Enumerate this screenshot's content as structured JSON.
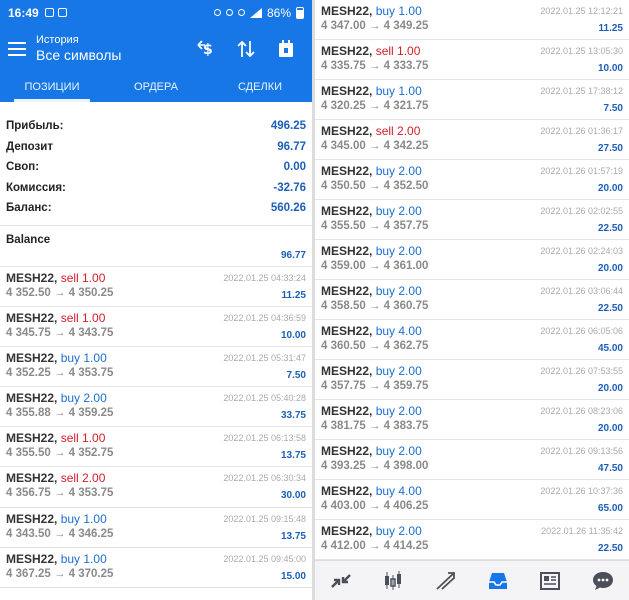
{
  "status": {
    "time": "16:49",
    "battery": "86%"
  },
  "toolbar": {
    "subtitle": "История",
    "title": "Все символы"
  },
  "tabs": [
    {
      "label": "ПОЗИЦИИ"
    },
    {
      "label": "ОРДЕРА"
    },
    {
      "label": "СДЕЛКИ"
    }
  ],
  "summary": [
    {
      "label": "Прибыль:",
      "value": "496.25"
    },
    {
      "label": "Депозит",
      "value": "96.77"
    },
    {
      "label": "Своп:",
      "value": "0.00"
    },
    {
      "label": "Комиссия:",
      "value": "-32.76"
    },
    {
      "label": "Баланс:",
      "value": "560.26"
    }
  ],
  "balance": {
    "title": "Balance",
    "value": "96.77"
  },
  "left_trades": [
    {
      "symbol": "MESH22,",
      "direction": "sell 1.00",
      "type": "sell",
      "prices": "4 352.50 → 4 350.25",
      "date": "2022.01.25 04:33:24",
      "profit": "11.25"
    },
    {
      "symbol": "MESH22,",
      "direction": "sell 1.00",
      "type": "sell",
      "prices": "4 345.75 → 4 343.75",
      "date": "2022.01.25 04:36:59",
      "profit": "10.00"
    },
    {
      "symbol": "MESH22,",
      "direction": "buy 1.00",
      "type": "buy",
      "prices": "4 352.25 → 4 353.75",
      "date": "2022.01.25 05:31:47",
      "profit": "7.50"
    },
    {
      "symbol": "MESH22,",
      "direction": "buy 2.00",
      "type": "buy",
      "prices": "4 355.88 → 4 359.25",
      "date": "2022.01.25 05:40:28",
      "profit": "33.75"
    },
    {
      "symbol": "MESH22,",
      "direction": "sell 1.00",
      "type": "sell",
      "prices": "4 355.50 → 4 352.75",
      "date": "2022.01.25 06:13:58",
      "profit": "13.75"
    },
    {
      "symbol": "MESH22,",
      "direction": "sell 2.00",
      "type": "sell",
      "prices": "4 356.75 → 4 353.75",
      "date": "2022.01.25 06:30:34",
      "profit": "30.00"
    },
    {
      "symbol": "MESH22,",
      "direction": "buy 1.00",
      "type": "buy",
      "prices": "4 343.50 → 4 346.25",
      "date": "2022.01.25 09:15:48",
      "profit": "13.75"
    },
    {
      "symbol": "MESH22,",
      "direction": "buy 1.00",
      "type": "buy",
      "prices": "4 367.25 → 4 370.25",
      "date": "2022.01.25 09:45:00",
      "profit": "15.00"
    }
  ],
  "right_trades": [
    {
      "symbol": "MESH22,",
      "direction": "buy 1.00",
      "type": "buy",
      "prices": "4 347.00 → 4 349.25",
      "date": "2022.01.25 12:12:21",
      "profit": "11.25"
    },
    {
      "symbol": "MESH22,",
      "direction": "sell 1.00",
      "type": "sell",
      "prices": "4 335.75 → 4 333.75",
      "date": "2022.01.25 13:05:30",
      "profit": "10.00"
    },
    {
      "symbol": "MESH22,",
      "direction": "buy 1.00",
      "type": "buy",
      "prices": "4 320.25 → 4 321.75",
      "date": "2022.01.25 17:38:12",
      "profit": "7.50"
    },
    {
      "symbol": "MESH22,",
      "direction": "sell 2.00",
      "type": "sell",
      "prices": "4 345.00 → 4 342.25",
      "date": "2022.01.26 01:36:17",
      "profit": "27.50"
    },
    {
      "symbol": "MESH22,",
      "direction": "buy 2.00",
      "type": "buy",
      "prices": "4 350.50 → 4 352.50",
      "date": "2022.01.26 01:57:19",
      "profit": "20.00"
    },
    {
      "symbol": "MESH22,",
      "direction": "buy 2.00",
      "type": "buy",
      "prices": "4 355.50 → 4 357.75",
      "date": "2022.01.26 02:02:55",
      "profit": "22.50"
    },
    {
      "symbol": "MESH22,",
      "direction": "buy 2.00",
      "type": "buy",
      "prices": "4 359.00 → 4 361.00",
      "date": "2022.01.26 02:24:03",
      "profit": "20.00"
    },
    {
      "symbol": "MESH22,",
      "direction": "buy 2.00",
      "type": "buy",
      "prices": "4 358.50 → 4 360.75",
      "date": "2022.01.26 03:06:44",
      "profit": "22.50"
    },
    {
      "symbol": "MESH22,",
      "direction": "buy 4.00",
      "type": "buy",
      "prices": "4 360.50 → 4 362.75",
      "date": "2022.01.26 06:05:06",
      "profit": "45.00"
    },
    {
      "symbol": "MESH22,",
      "direction": "buy 2.00",
      "type": "buy",
      "prices": "4 357.75 → 4 359.75",
      "date": "2022.01.26 07:53:55",
      "profit": "20.00"
    },
    {
      "symbol": "MESH22,",
      "direction": "buy 2.00",
      "type": "buy",
      "prices": "4 381.75 → 4 383.75",
      "date": "2022.01.26 08:23:06",
      "profit": "20.00"
    },
    {
      "symbol": "MESH22,",
      "direction": "buy 2.00",
      "type": "buy",
      "prices": "4 393.25 → 4 398.00",
      "date": "2022.01.26 09:13:56",
      "profit": "47.50"
    },
    {
      "symbol": "MESH22,",
      "direction": "buy 4.00",
      "type": "buy",
      "prices": "4 403.00 → 4 406.25",
      "date": "2022.01.26 10:37:36",
      "profit": "65.00"
    },
    {
      "symbol": "MESH22,",
      "direction": "buy 2.00",
      "type": "buy",
      "prices": "4 412.00 → 4 414.25",
      "date": "2022.01.26 11:35:42",
      "profit": "22.50"
    }
  ],
  "bottom_nav": [
    {
      "icon": "quotes-icon"
    },
    {
      "icon": "chart-icon"
    },
    {
      "icon": "trade-icon"
    },
    {
      "icon": "history-icon",
      "active": true
    },
    {
      "icon": "news-icon"
    },
    {
      "icon": "messages-icon"
    }
  ],
  "colors": {
    "accent": "#1777e6",
    "sell": "#d0202a",
    "buy": "#1b6fd1",
    "value": "#1c5fb8"
  }
}
